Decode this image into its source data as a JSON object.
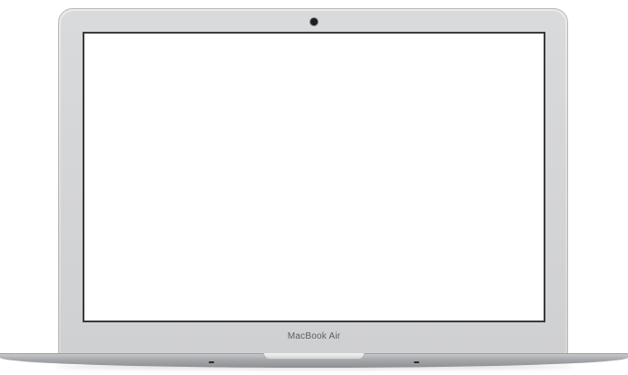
{
  "device": {
    "brand_label": "MacBook Air",
    "screen_color": "#ffffff",
    "bezel_color": "#dfe0e2"
  },
  "icons": {
    "camera": "camera-icon"
  }
}
